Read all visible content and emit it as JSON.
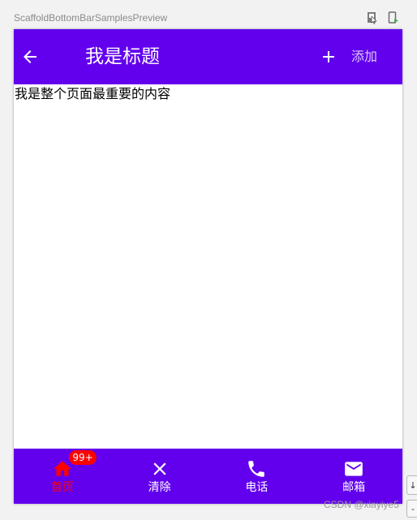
{
  "preview": {
    "title": "ScaffoldBottomBarSamplesPreview"
  },
  "app": {
    "colors": {
      "primary": "#6200ee",
      "selected": "#ff0000",
      "on_primary": "#ffffff",
      "badge": "#ff0000"
    },
    "top_bar": {
      "back_icon": "arrow-back-icon",
      "title": "我是标题",
      "add_icon": "add-icon",
      "add_text": "添加"
    },
    "content": {
      "text": "我是整个页面最重要的内容"
    },
    "bottom_bar": {
      "items": [
        {
          "icon": "home-icon",
          "label": "首页",
          "selected": true,
          "badge": "99+"
        },
        {
          "icon": "close-icon",
          "label": "清除",
          "selected": false
        },
        {
          "icon": "phone-icon",
          "label": "电话",
          "selected": false
        },
        {
          "icon": "mail-icon",
          "label": "邮箱",
          "selected": false
        }
      ]
    }
  },
  "watermark": "CSDN @xiayiye5"
}
